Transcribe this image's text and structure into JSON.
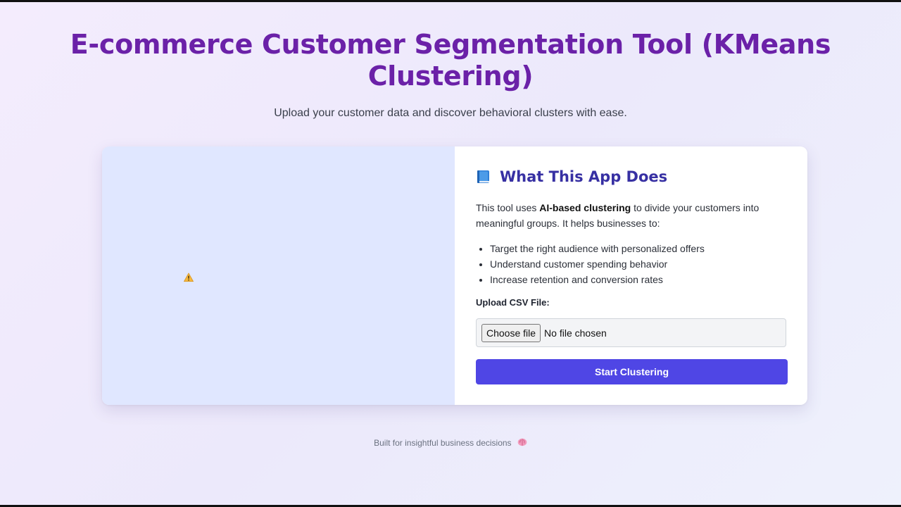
{
  "header": {
    "title": "E-commerce Customer Segmentation Tool (KMeans Clustering)",
    "subtitle": "Upload your customer data and discover behavioral clusters with ease."
  },
  "illustration": {
    "icon": "warning-icon"
  },
  "about": {
    "heading_icon": "book-icon",
    "heading": "What This App Does",
    "intro_before": "This tool uses ",
    "intro_bold": "AI-based clustering",
    "intro_after": " to divide your customers into meaningful groups. It helps businesses to:",
    "features": [
      "Target the right audience with personalized offers",
      "Understand customer spending behavior",
      "Increase retention and conversion rates"
    ]
  },
  "upload": {
    "label": "Upload CSV File:",
    "choose_label": "Choose file",
    "status": "No file chosen"
  },
  "actions": {
    "start_label": "Start Clustering"
  },
  "footer": {
    "text": "Built for insightful business decisions",
    "icon": "brain-icon"
  },
  "colors": {
    "title": "#6b21a8",
    "heading": "#3730a3",
    "button": "#4f46e5",
    "left_panel": "#e0e7ff"
  }
}
